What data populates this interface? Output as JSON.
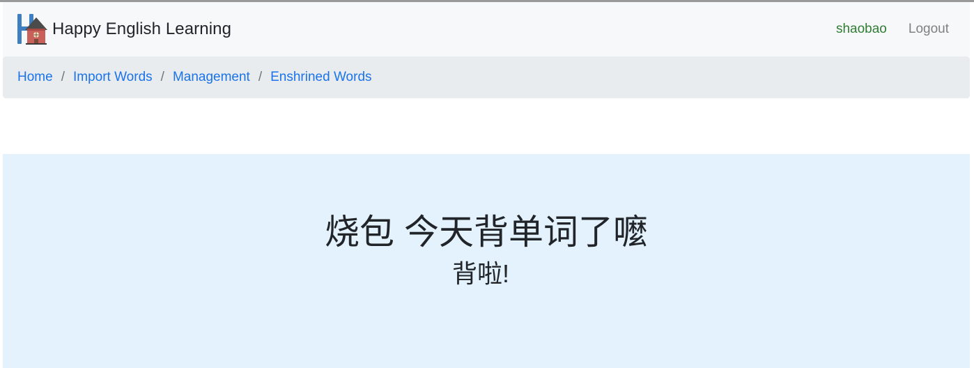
{
  "navbar": {
    "brand_text": "Happy English Learning",
    "logo_icon": "house-h-logo-icon",
    "username": "shaobao",
    "logout_label": "Logout"
  },
  "breadcrumb": {
    "items": [
      {
        "label": "Home"
      },
      {
        "label": "Import Words"
      },
      {
        "label": "Management"
      },
      {
        "label": "Enshrined Words"
      }
    ],
    "separator": "/"
  },
  "jumbotron": {
    "title": "烧包 今天背单词了嚒",
    "subtitle": "背啦!"
  },
  "colors": {
    "navbar_bg": "#f7f8fa",
    "breadcrumb_bg": "#e9ecef",
    "link": "#1a73e8",
    "username": "#2f7d32",
    "logout": "#808080",
    "jumbotron_bg": "#e3f2fd"
  }
}
